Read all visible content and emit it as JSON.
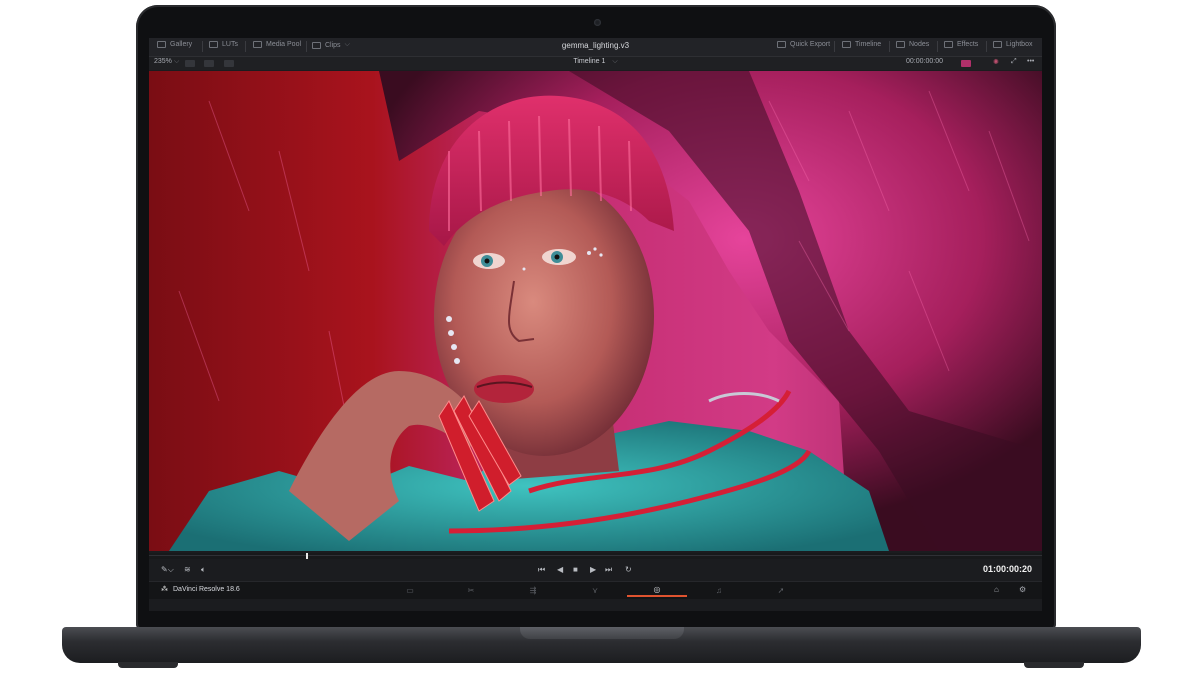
{
  "top_bar": {
    "left_items": [
      {
        "label": "Gallery",
        "icon": "gallery-icon"
      },
      {
        "label": "LUTs",
        "icon": "luts-icon"
      },
      {
        "label": "Media Pool",
        "icon": "media-pool-icon"
      },
      {
        "label": "Clips",
        "icon": "clips-icon"
      }
    ],
    "project_title": "gemma_lighting.v3",
    "right_items": [
      {
        "label": "Quick Export",
        "icon": "export-icon"
      },
      {
        "label": "Timeline",
        "icon": "timeline-icon"
      },
      {
        "label": "Nodes",
        "icon": "nodes-icon"
      },
      {
        "label": "Effects",
        "icon": "effects-icon"
      },
      {
        "label": "Lightbox",
        "icon": "lightbox-icon"
      }
    ]
  },
  "view_bar": {
    "zoom": "235%",
    "zoom_chevron": "⌵",
    "timeline_name": "Timeline 1",
    "timeline_chevron": "⌵",
    "source_timecode": "00:00:00:00",
    "more": "•••"
  },
  "transport": {
    "buttons": [
      "⏮",
      "◀",
      "■",
      "▶",
      "⏭",
      "↻"
    ],
    "timecode": "01:00:00:20"
  },
  "pages": {
    "brand": "DaVinci Resolve 18.6",
    "items": [
      {
        "name": "media",
        "glyph": "▭"
      },
      {
        "name": "cut",
        "glyph": "✂"
      },
      {
        "name": "edit",
        "glyph": "⇶"
      },
      {
        "name": "fusion",
        "glyph": "⋎"
      },
      {
        "name": "color",
        "glyph": "◎"
      },
      {
        "name": "fairlight",
        "glyph": "♫"
      },
      {
        "name": "deliver",
        "glyph": "➚"
      }
    ],
    "active": "color",
    "home_icon": "⌂",
    "settings_icon": "⚙"
  },
  "colors": {
    "accent": "#e0532f",
    "background_fur": "#c42a68",
    "jacket": "#29a7a6"
  }
}
